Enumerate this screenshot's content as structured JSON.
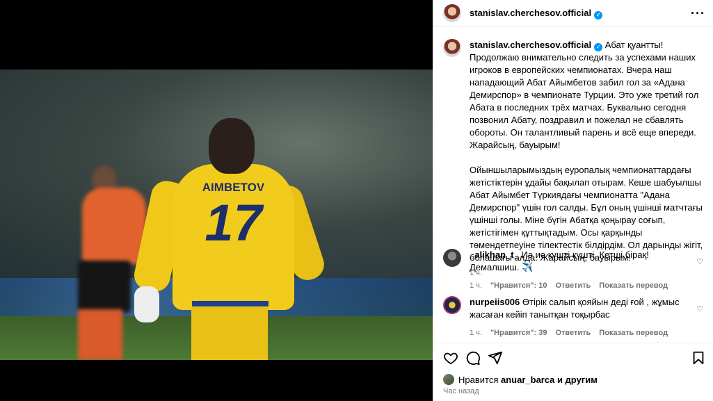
{
  "post": {
    "username": "stanislav.cherchesov.official",
    "caption_text": "Абат қуантты! Продолжаю внимательно следить за успехами наших игроков в европейских чемпионатах. Вчера наш нападающий Абат Айымбетов забил гол за «Адана Демирспор» в чемпионате Турции. Это уже третий гол Абата в последних трёх матчах. Буквально сегодня позвонил Абату, поздравил и пожелал не сбавлять обороты. Он талантливый парень и всё еще впереди. Жарайсың, бауырым!\n\nОйыншыларымыздың еуропалық чемпионаттардағы жетістіктерін ұдайы бақылап отырам. Кеше шабуылшы Абат Айымбет Түркиядағы чемпионатта \"Адана Демирспор\" үшін гол салды. Бұл оның үшінші матчтағы үшінші голы. Міне бүгін Абатқа қоңырау соғып, жетістігімен құттықтадым. Осы қарқынды төмендетпеуіне тілектестік білдірдім. Ол дарынды жігіт, болашағы алда. Жарайсың, бауырым!",
    "caption_time": "1 ч."
  },
  "media": {
    "shirt_name": "AIMBETOV",
    "shirt_number": "17"
  },
  "comments": [
    {
      "username": "_alikhan_t_",
      "text": "Иә иә күшті күшті. Кетші бірақ! Демалшиш. ✈️",
      "time": "1 ч.",
      "likes": "\"Нравится\": 10",
      "reply": "Ответить",
      "translate": "Показать перевод"
    },
    {
      "username": "nurpeiis006",
      "text": "Өтірік салып қояйын деді ғой , жұмыс жасаған кейіп танытқан тоқырбас",
      "time": "1 ч.",
      "likes": "\"Нравится\": 39",
      "reply": "Ответить",
      "translate": "Показать перевод"
    }
  ],
  "likes_line": {
    "prefix": "Нравится",
    "user": "anuar_barca",
    "suffix": "и другим"
  },
  "posted_ago": "Час назад",
  "icons": {
    "more": "more-options-icon",
    "like": "heart-icon",
    "comment": "comment-icon",
    "share": "share-icon",
    "save": "bookmark-icon",
    "verified": "verified-badge-icon"
  },
  "colors": {
    "verified": "#0095f6",
    "muted": "#737373",
    "divider": "#efefef"
  }
}
